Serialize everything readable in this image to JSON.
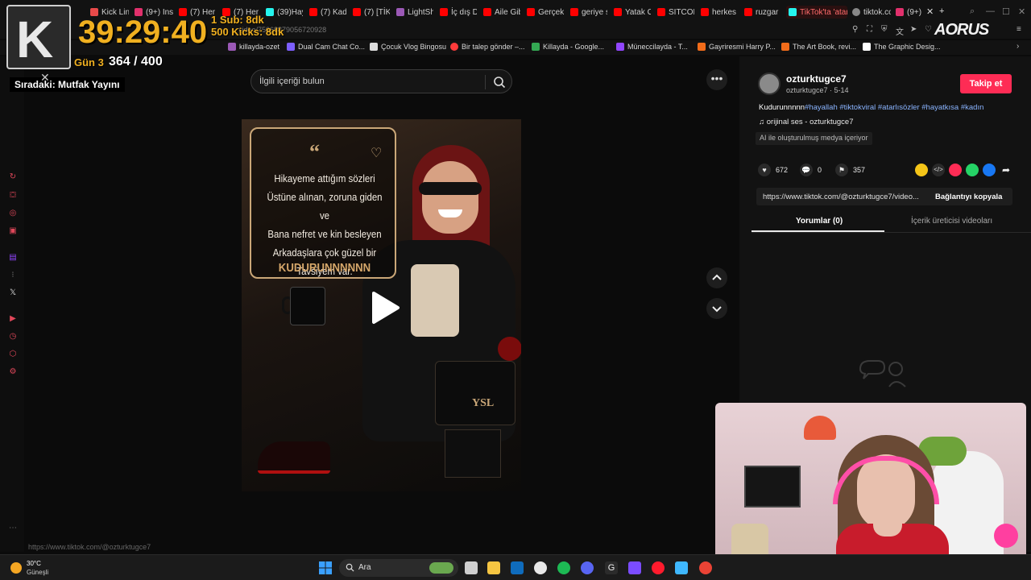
{
  "browser": {
    "tabs": [
      {
        "label": "Kick Lin",
        "color": "#e84a4a"
      },
      {
        "label": "(9+) Ins",
        "color": "#e1306c"
      },
      {
        "label": "(7) Her",
        "color": "#ff0000"
      },
      {
        "label": "(7) Her",
        "color": "#ff0000"
      },
      {
        "label": "(39)Hay",
        "color": "#25f4ee"
      },
      {
        "label": "(7) Kad",
        "color": "#ff0000"
      },
      {
        "label": "(7) [TİK",
        "color": "#ff0000"
      },
      {
        "label": "LightSh",
        "color": "#9b59b6"
      },
      {
        "label": "İç dış D",
        "color": "#ff0000"
      },
      {
        "label": "Aile Gib",
        "color": "#ff0000"
      },
      {
        "label": "Gerçek",
        "color": "#ff0000"
      },
      {
        "label": "geriye s",
        "color": "#ff0000"
      },
      {
        "label": "Yatak O",
        "color": "#ff0000"
      },
      {
        "label": "SITCOM",
        "color": "#ff0000"
      },
      {
        "label": "herkes",
        "color": "#ff0000"
      },
      {
        "label": "ruzgar",
        "color": "#ff0000"
      },
      {
        "label": "TikTok'ta 'atan",
        "color": "#25f4ee",
        "active": true
      },
      {
        "label": "tiktok.co",
        "color": "#888888"
      },
      {
        "label": "(9+)",
        "color": "#e1306c"
      }
    ],
    "url_fragment": "video/75068879056720928",
    "brand_logo": "AORUS",
    "bookmarks": [
      {
        "label": "killayda-ozet",
        "color": "#9b59b6"
      },
      {
        "label": "Dual Cam Chat Co...",
        "color": "#7d5fff"
      },
      {
        "label": "Çocuk Vlog Bingosu",
        "color": "#dddddd"
      },
      {
        "label": "Bir talep gönder –...",
        "color": "#ff3b3b"
      },
      {
        "label": "Killayda - Google...",
        "color": "#34a853"
      },
      {
        "label": "Müneccilayda - T...",
        "color": "#9146ff"
      },
      {
        "label": "Gayriresmi Harry P...",
        "color": "#f26c1a"
      },
      {
        "label": "The Art Book, revi...",
        "color": "#f26c1a"
      },
      {
        "label": "The Graphic Desig...",
        "color": "#ffffff"
      }
    ]
  },
  "overlay": {
    "timer": "39:29:40",
    "sub_line": "1 Sub: 8dk",
    "kicks_line": "500 Kicks: 8dk",
    "day_label": "Gün 3",
    "day_count": "364 / 400",
    "next_label": "Sıradaki: Mutfak Yayını",
    "logo_letter": "K"
  },
  "center": {
    "search_placeholder": "İlgili içeriği bulun",
    "quote_lines": [
      "Hikayeme attığım sözleri",
      "Üstüne alınan, zoruna giden ve",
      "Bana nefret ve kin besleyen",
      "Arkadaşlara çok güzel bir",
      "Tavsiyem var."
    ],
    "quote_shout": "KUDURUNNNNNN",
    "status_url": "https://www.tiktok.com/@ozturktugce7"
  },
  "right": {
    "username": "ozturktugce7",
    "user_sub": "ozturktugce7 · 5-14",
    "follow_label": "Takip et",
    "caption_text": "Kudurunnnnn",
    "caption_tags": "#hayallah #tiktokviral #atarlısözler #hayatkısa #kadın",
    "sound": "orijinal ses - ozturktugce7",
    "ai_tag": "AI ile oluşturulmuş medya içeriyor",
    "likes": "672",
    "comments": "0",
    "saves": "357",
    "url": "https://www.tiktok.com/@ozturktugce7/video...",
    "copy_label": "Bağlantıyı kopyala",
    "tab_comments": "Yorumlar (0)",
    "tab_creator": "İçerik üreticisi videoları"
  },
  "taskbar": {
    "temp": "30°C",
    "weather": "Güneşli",
    "search_placeholder": "Ara"
  }
}
